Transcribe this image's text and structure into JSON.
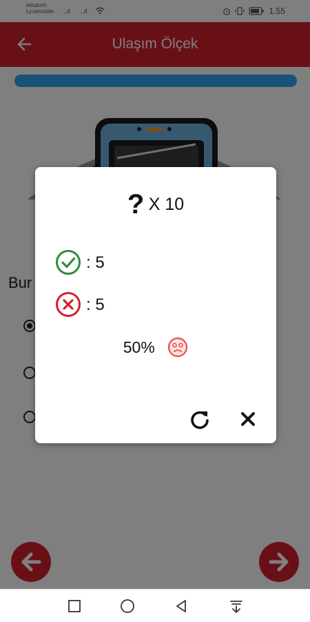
{
  "status_bar": {
    "carrier_line1": "edupurn",
    "carrier_line2": "Lycamobile",
    "signal1": "..ıl",
    "signal2": "..ıl",
    "time": "1.55"
  },
  "app_bar": {
    "title": "Ulaşım Ölçek"
  },
  "background": {
    "question_partial": "Bur",
    "progress_fraction": 1.0
  },
  "result_dialog": {
    "total_label": "X 10",
    "correct_label": ": 5",
    "wrong_label": ": 5",
    "percent_label": "50%",
    "colors": {
      "correct": "#2e8b3e",
      "wrong": "#d61f2c",
      "face": "#ef5350"
    }
  },
  "colors": {
    "primary": "#d3202f",
    "progress": "#2ea5ee"
  },
  "icons": [
    "back-arrow-icon",
    "question-mark-icon",
    "check-circle-icon",
    "x-circle-icon",
    "sad-face-icon",
    "retry-icon",
    "close-icon",
    "prev-arrow-icon",
    "next-arrow-icon",
    "recent-apps-icon",
    "home-icon",
    "back-icon",
    "notification-pull-icon"
  ]
}
